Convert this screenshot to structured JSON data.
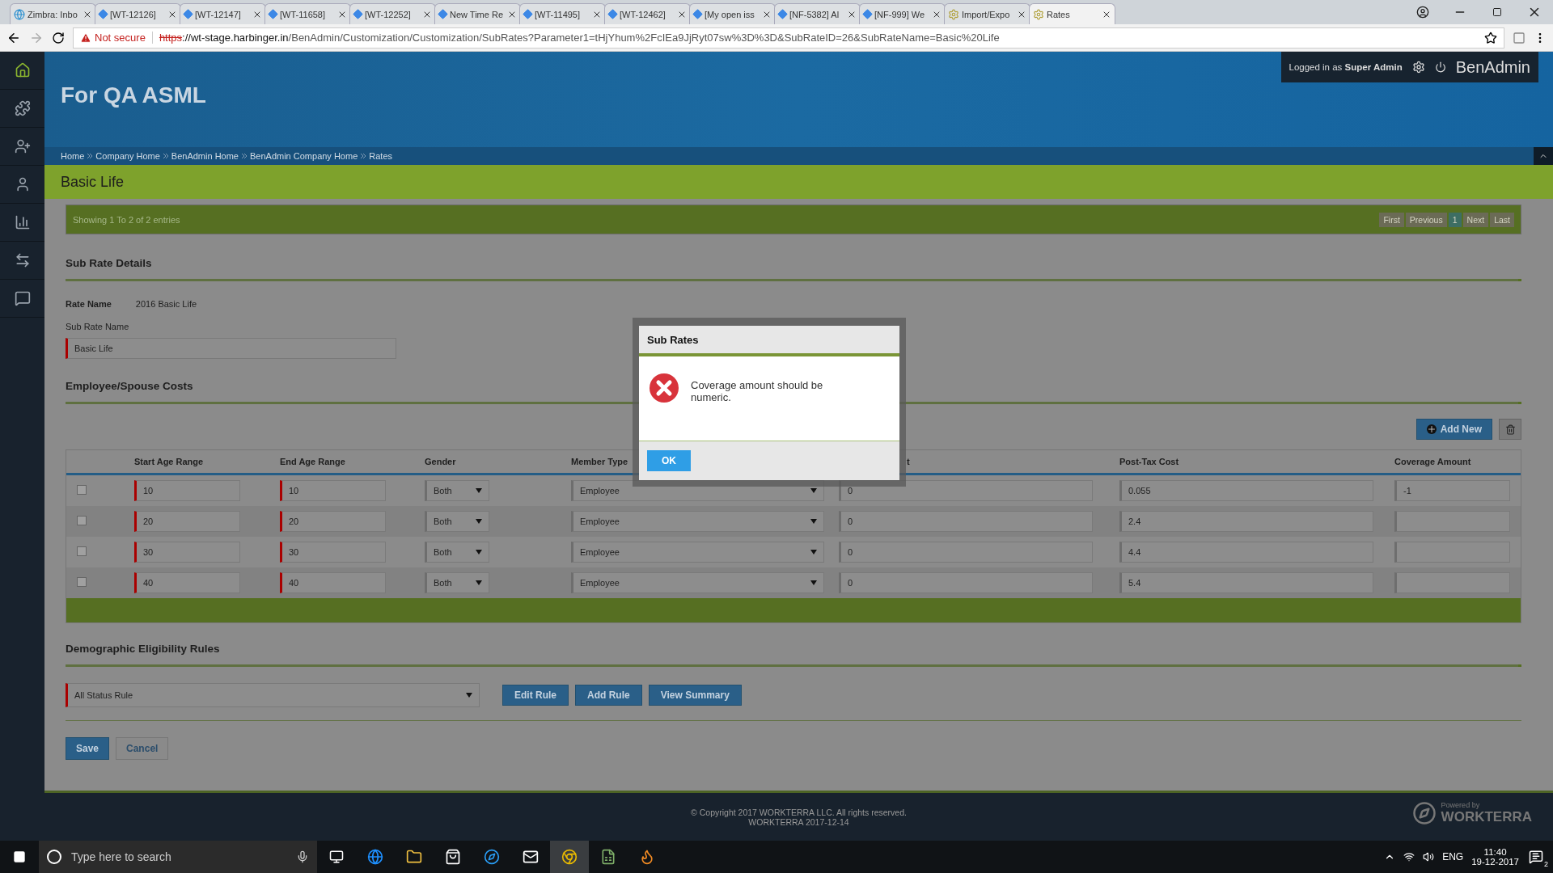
{
  "browser": {
    "tabs": [
      {
        "title": "Zimbra: Inbo",
        "kind": "mail",
        "selected": false
      },
      {
        "title": "[WT-12126]",
        "kind": "issue",
        "selected": false
      },
      {
        "title": "[WT-12147]",
        "kind": "issue",
        "selected": false
      },
      {
        "title": "[WT-11658]",
        "kind": "issue",
        "selected": false
      },
      {
        "title": "[WT-12252]",
        "kind": "issue",
        "selected": false
      },
      {
        "title": "New Time Re",
        "kind": "issue",
        "selected": false
      },
      {
        "title": "[WT-11495]",
        "kind": "issue",
        "selected": false
      },
      {
        "title": "[WT-12462]",
        "kind": "issue",
        "selected": false
      },
      {
        "title": "[My open iss",
        "kind": "issue",
        "selected": false
      },
      {
        "title": "[NF-5382] Al",
        "kind": "issue",
        "selected": false
      },
      {
        "title": "[NF-999] We",
        "kind": "issue",
        "selected": false
      },
      {
        "title": "Import/Expo",
        "kind": "site",
        "selected": false
      },
      {
        "title": "Rates",
        "kind": "site",
        "selected": true
      }
    ],
    "security": "Not secure",
    "url_scheme": "https",
    "url_host": "://wt-stage.harbinger.in",
    "url_path": "/BenAdmin/Customization/Customization/SubRates?Parameter1=tHjYhum%2FcIEa9JjRyt07sw%3D%3D&SubRateID=26&SubRateName=Basic%20Life"
  },
  "header": {
    "title": "For QA ASML",
    "logged_in_prefix": "Logged in as",
    "user": "Super Admin",
    "brand": "BenAdmin"
  },
  "breadcrumbs": [
    "Home",
    "Company Home",
    "BenAdmin Home",
    "BenAdmin Company Home",
    "Rates"
  ],
  "page_title": "Basic Life",
  "pager": {
    "summary": "Showing 1 To 2 of 2 entries",
    "buttons": [
      {
        "label": "First",
        "selected": false
      },
      {
        "label": "Previous",
        "selected": false
      },
      {
        "label": "1",
        "selected": true
      },
      {
        "label": "Next",
        "selected": false
      },
      {
        "label": "Last",
        "selected": false
      }
    ]
  },
  "sub_rate_details": {
    "heading": "Sub Rate Details",
    "rate_name_label": "Rate Name",
    "rate_name": "2016 Basic Life",
    "sub_rate_name_label": "Sub Rate Name",
    "sub_rate_name": "Basic Life"
  },
  "costs": {
    "heading": "Employee/Spouse Costs",
    "add_new": "Add New",
    "columns": [
      "Start Age Range",
      "End Age Range",
      "Gender",
      "Member Type",
      "t",
      "Post-Tax Cost",
      "Coverage Amount"
    ],
    "rows": [
      {
        "checked": false,
        "start": "10",
        "end": "10",
        "gender": "Both",
        "member_type": "Employee",
        "pre_tax": "0",
        "post_tax": "0.055",
        "coverage": "-1"
      },
      {
        "checked": false,
        "start": "20",
        "end": "20",
        "gender": "Both",
        "member_type": "Employee",
        "pre_tax": "0",
        "post_tax": "2.4"
      },
      {
        "checked": false,
        "start": "30",
        "end": "30",
        "gender": "Both",
        "member_type": "Employee",
        "pre_tax": "0",
        "post_tax": "4.4"
      },
      {
        "checked": false,
        "start": "40",
        "end": "40",
        "gender": "Both",
        "member_type": "Employee",
        "pre_tax": "0",
        "post_tax": "5.4"
      }
    ]
  },
  "eligibility": {
    "heading": "Demographic Eligibility Rules",
    "rule": "All Status Rule",
    "buttons": [
      "Edit Rule",
      "Add Rule",
      "View Summary"
    ]
  },
  "actions": [
    {
      "label": "Save",
      "kind": "primary"
    },
    {
      "label": "Cancel",
      "kind": "secondary"
    }
  ],
  "footer": {
    "copyright": "© Copyright 2017 WORKTERRA LLC. All rights reserved.",
    "version": "WORKTERRA 2017-12-14",
    "powered_by": "Powered by",
    "powered_brand": "WORKTERRA"
  },
  "dialog": {
    "title": "Sub Rates",
    "message": "Coverage amount should be numeric.",
    "ok": "OK"
  },
  "taskbar": {
    "search_placeholder": "Type here to search",
    "language": "ENG",
    "time": "11:40",
    "date": "19-12-2017",
    "notifications": "2"
  }
}
